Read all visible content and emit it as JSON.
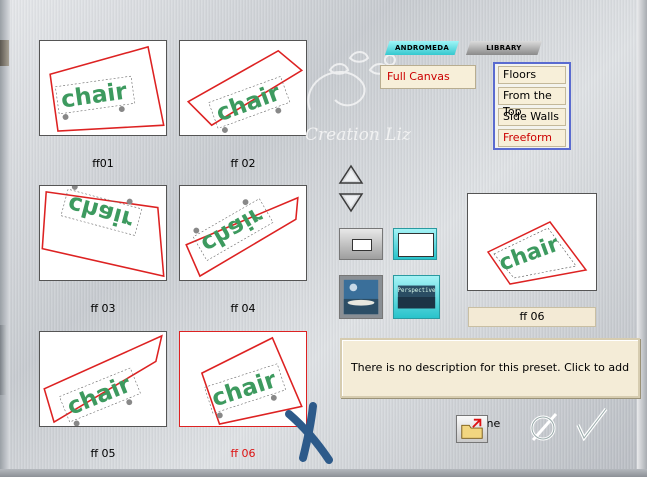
{
  "tabs": {
    "andromeda": "ANDROMEDA",
    "library": "LIBRARY"
  },
  "category_selected": "Full Canvas",
  "menu": {
    "items": [
      "Floors",
      "From the Top",
      "Side Walls",
      "Freeform"
    ],
    "active": "Freeform"
  },
  "thumb_text": "chair",
  "thumbnails": [
    {
      "label": "ff01",
      "selected": false
    },
    {
      "label": "ff 02",
      "selected": false
    },
    {
      "label": "ff 03",
      "selected": false
    },
    {
      "label": "ff 04",
      "selected": false
    },
    {
      "label": "ff 05",
      "selected": false
    },
    {
      "label": "ff 06",
      "selected": true
    }
  ],
  "preview": {
    "label": "ff 06"
  },
  "perspective_icon_text": "Perspective",
  "description": "There is no description for this preset. Click to add one",
  "watermark": "Creation Liz",
  "colors": {
    "selected_red": "#d11111",
    "accent_cyan": "#35c8cf",
    "menu_border": "#5a6bd0",
    "text_green": "#3d9a5f"
  },
  "icons": [
    "up-arrow-icon",
    "down-arrow-icon",
    "folder-export-icon",
    "cancel-icon",
    "checkmark-icon"
  ]
}
